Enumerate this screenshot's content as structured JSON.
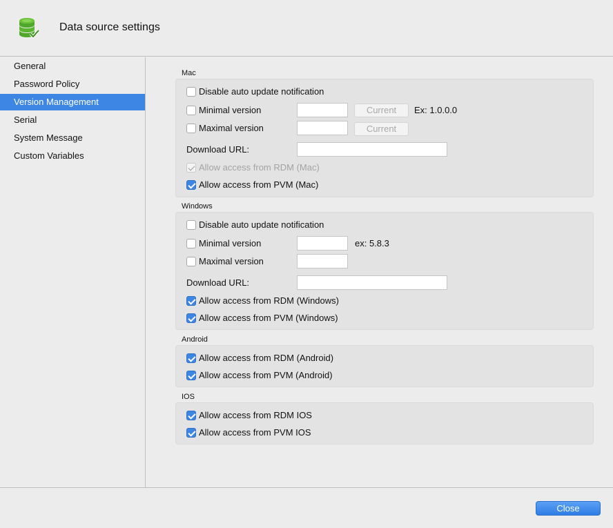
{
  "header": {
    "title": "Data source settings",
    "icon": "database-check-icon"
  },
  "sidebar": {
    "items": [
      {
        "label": "General"
      },
      {
        "label": "Password Policy"
      },
      {
        "label": "Version Management"
      },
      {
        "label": "Serial"
      },
      {
        "label": "System Message"
      },
      {
        "label": "Custom Variables"
      }
    ],
    "selected": "Version Management"
  },
  "mac": {
    "section_label": "Mac",
    "disable_auto_update": {
      "label": "Disable auto update notification",
      "checked": false
    },
    "minimal_version": {
      "label": "Minimal version",
      "checked": false,
      "value": "",
      "button": "Current",
      "hint": "Ex: 1.0.0.0"
    },
    "maximal_version": {
      "label": "Maximal version",
      "checked": false,
      "value": "",
      "button": "Current"
    },
    "download_url": {
      "label": "Download URL:",
      "value": ""
    },
    "allow_rdm": {
      "label": "Allow access from RDM (Mac)",
      "checked": true,
      "disabled": true
    },
    "allow_pvm": {
      "label": "Allow access from PVM (Mac)",
      "checked": true
    }
  },
  "windows": {
    "section_label": "Windows",
    "disable_auto_update": {
      "label": "Disable auto update notification",
      "checked": false
    },
    "minimal_version": {
      "label": "Minimal version",
      "checked": false,
      "value": "",
      "hint": "ex: 5.8.3"
    },
    "maximal_version": {
      "label": "Maximal version",
      "checked": false,
      "value": ""
    },
    "download_url": {
      "label": "Download URL:",
      "value": ""
    },
    "allow_rdm": {
      "label": "Allow access from RDM (Windows)",
      "checked": true
    },
    "allow_pvm": {
      "label": "Allow access from PVM (Windows)",
      "checked": true
    }
  },
  "android": {
    "section_label": "Android",
    "allow_rdm": {
      "label": "Allow access from RDM (Android)",
      "checked": true
    },
    "allow_pvm": {
      "label": "Allow access from PVM (Android)",
      "checked": true
    }
  },
  "ios": {
    "section_label": "IOS",
    "allow_rdm": {
      "label": "Allow access from RDM IOS",
      "checked": true
    },
    "allow_pvm": {
      "label": "Allow access from PVM IOS",
      "checked": true
    }
  },
  "footer": {
    "close_label": "Close"
  },
  "colors": {
    "accent": "#3d86e3",
    "icon_green": "#5cb531"
  }
}
